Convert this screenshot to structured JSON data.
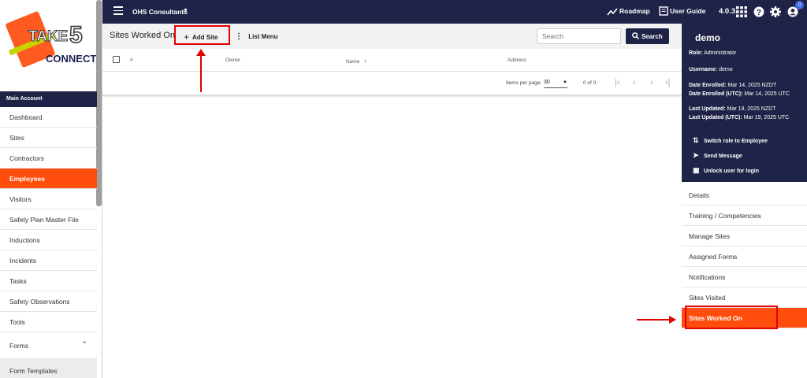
{
  "app": {
    "logo_text_take": "TAKE",
    "logo_text_five": "5",
    "logo_text_connect": "CONNECT"
  },
  "sidebar": {
    "section_label": "Main Account",
    "items": [
      {
        "label": "Dashboard"
      },
      {
        "label": "Sites"
      },
      {
        "label": "Contractors"
      },
      {
        "label": "Employees"
      },
      {
        "label": "Visitors"
      },
      {
        "label": "Safety Plan Master File"
      },
      {
        "label": "Inductions"
      },
      {
        "label": "Incidents"
      },
      {
        "label": "Tasks"
      },
      {
        "label": "Safety Observations"
      },
      {
        "label": "Tools"
      },
      {
        "label": "Forms"
      },
      {
        "label": "Form Templates"
      }
    ],
    "active_item": "Employees"
  },
  "topbar": {
    "org_name": "OHS Consultants",
    "roadmap_label": "Roadmap",
    "user_guide_label": "User Guide",
    "version": "4.0.3",
    "notification_count": "0"
  },
  "toolbar": {
    "page_title": "Sites Worked On",
    "add_site_label": "Add Site",
    "list_menu_label": "List Menu",
    "search_placeholder": "Search",
    "search_button_label": "Search"
  },
  "table": {
    "columns": [
      "#",
      "Owner",
      "Name",
      "Address"
    ],
    "rows": []
  },
  "pager": {
    "items_per_page_label": "Items per page:",
    "items_per_page": "30",
    "range": "0 of 0"
  },
  "profile": {
    "name": "demo",
    "role_label": "Role:",
    "role": "Administrator",
    "username_label": "Username:",
    "username": "demo",
    "date_enrolled_label": "Date Enrolled:",
    "date_enrolled": "Mar 14, 2025 NZDT",
    "date_enrolled_utc_label": "Date Enrolled (UTC):",
    "date_enrolled_utc": "Mar 14, 2025 UTC",
    "last_updated_label": "Last Updated:",
    "last_updated": "Mar 19, 2025 NZDT",
    "last_updated_utc_label": "Last Updated (UTC):",
    "last_updated_utc": "Mar 19, 2025 UTC",
    "actions": {
      "switch_role": "Switch role to Employee",
      "send_message": "Send Message",
      "unlock": "Unlock user for login"
    }
  },
  "right_nav": {
    "items": [
      {
        "label": "Details"
      },
      {
        "label": "Training / Competencies"
      },
      {
        "label": "Manage Sites"
      },
      {
        "label": "Assigned Forms"
      },
      {
        "label": "Notifications"
      },
      {
        "label": "Sites Visited"
      },
      {
        "label": "Sites Worked On"
      }
    ],
    "active_item": "Sites Worked On"
  },
  "colors": {
    "navy": "#1f2347",
    "accent_orange": "#ff4d0d",
    "annotation_red": "#e30000"
  }
}
